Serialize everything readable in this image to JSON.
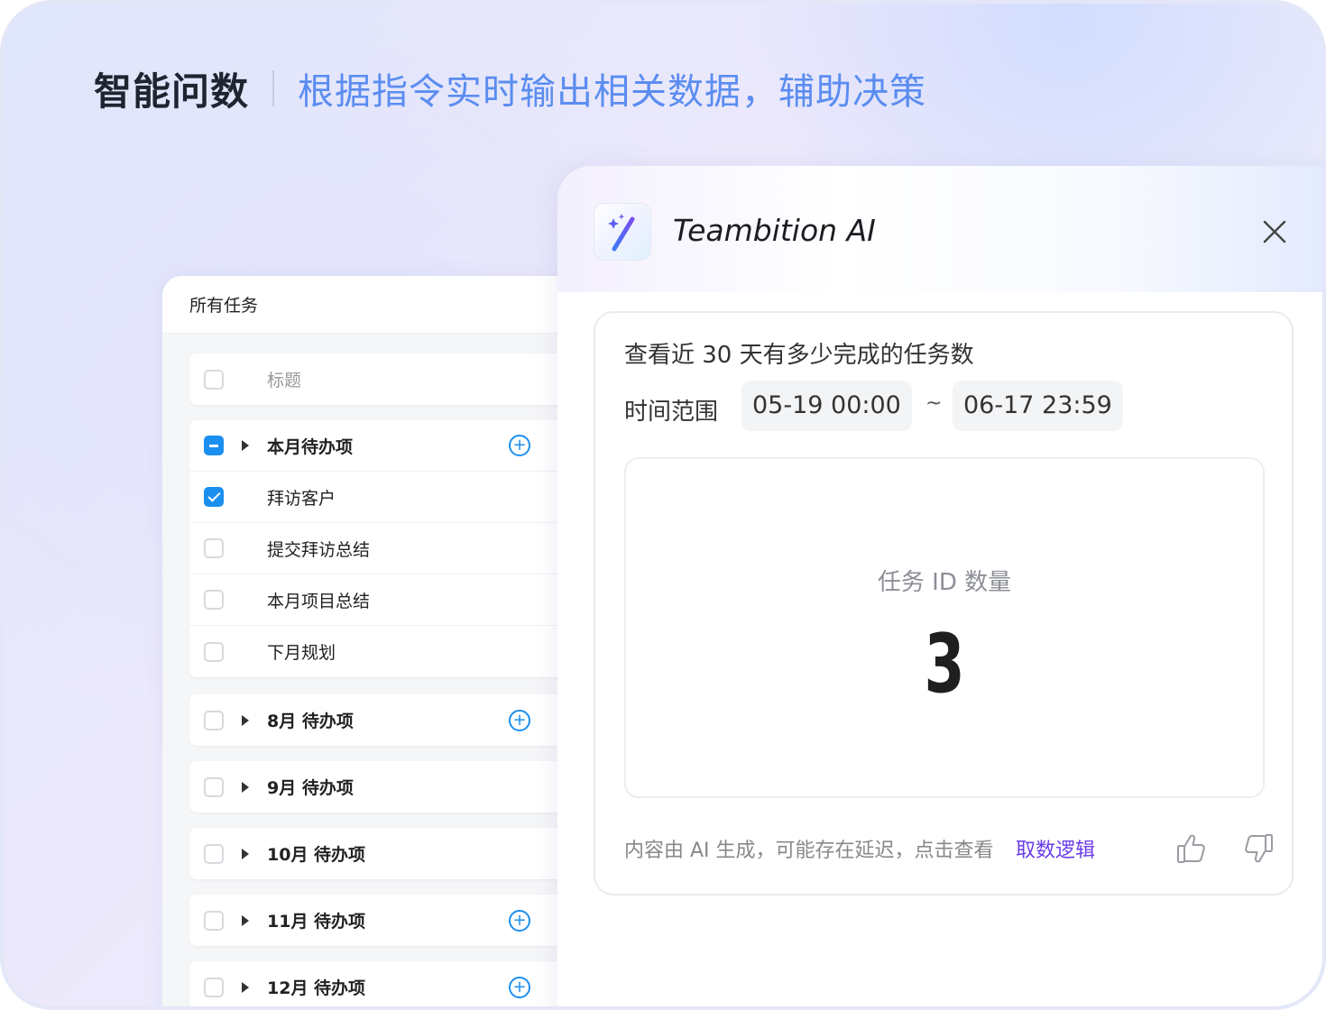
{
  "header": {
    "title": "智能问数",
    "subtitle": "根据指令实时输出相关数据，辅助决策"
  },
  "task_panel": {
    "title": "所有任务",
    "column_header": "标题",
    "current_group": {
      "label": "本月待办项",
      "checkbox": "partial",
      "items": [
        {
          "label": "拜访客户",
          "checked": true
        },
        {
          "label": "提交拜访总结",
          "checked": false
        },
        {
          "label": "本月项目总结",
          "checked": false
        },
        {
          "label": "下月规划",
          "checked": false
        }
      ]
    },
    "groups": [
      {
        "label": "8月 待办项",
        "has_add": true
      },
      {
        "label": "9月 待办项",
        "has_add": false
      },
      {
        "label": "10月 待办项",
        "has_add": false
      },
      {
        "label": "11月 待办项",
        "has_add": true
      },
      {
        "label": "12月 待办项",
        "has_add": true
      }
    ]
  },
  "ai_panel": {
    "title": "Teambition AI",
    "question": "查看近 30 天有多少完成的任务数",
    "range_label": "时间范围",
    "range_start": "05-19 00:00",
    "range_separator": "~",
    "range_end": "06-17 23:59",
    "metric_label": "任务 ID 数量",
    "metric_value": "3",
    "footer_note": "内容由 AI 生成，可能存在延迟，点击查看",
    "footer_link": "取数逻辑",
    "accent_color": "#6a3de8"
  },
  "icons": {
    "logo": "magic-wand-icon",
    "close": "close-icon",
    "like": "thumbs-up-icon",
    "dislike": "thumbs-down-icon",
    "add": "plus-circle-icon",
    "expand": "caret-right-icon"
  }
}
